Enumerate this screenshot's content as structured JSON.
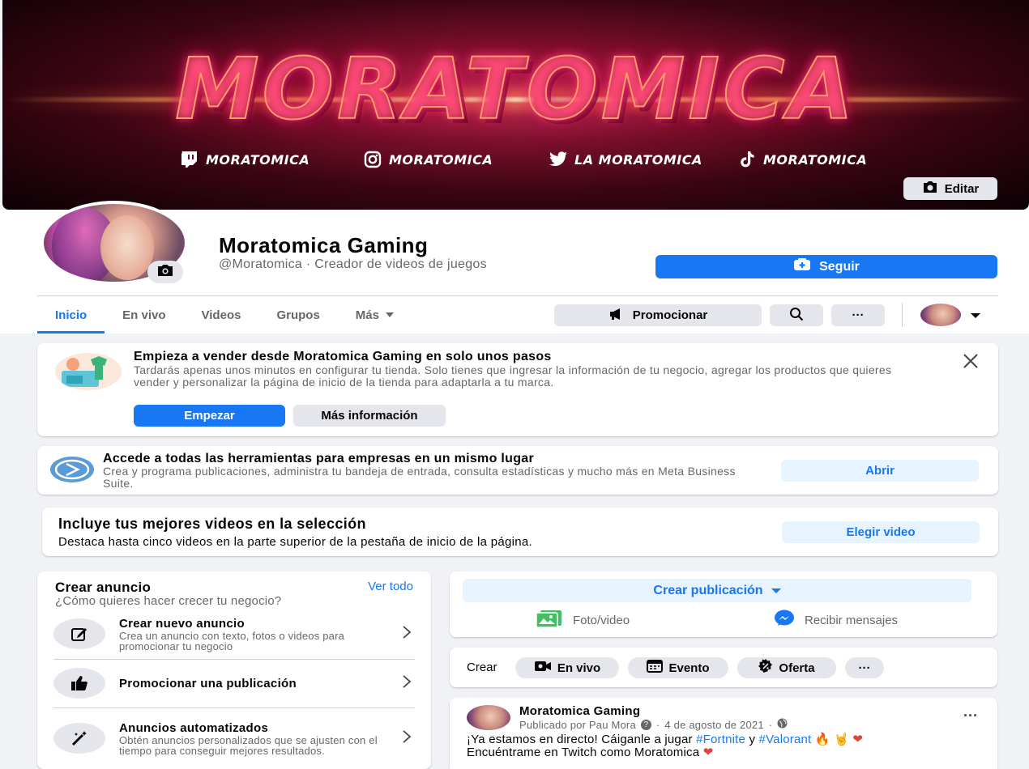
{
  "cover": {
    "brand_text": "MORATOMICA",
    "socials": [
      {
        "icon": "twitch-icon",
        "label": "MORATOMICA"
      },
      {
        "icon": "instagram-icon",
        "label": "MORATOMICA"
      },
      {
        "icon": "twitter-icon",
        "label": "LA MORATOMICA"
      },
      {
        "icon": "tiktok-icon",
        "label": "MORATOMICA"
      }
    ],
    "edit_label": "Editar"
  },
  "profile": {
    "name": "Moratomica Gaming",
    "subtitle": "@Moratomica · Creador de videos de juegos",
    "follow_label": "Seguir"
  },
  "tabs": [
    "Inicio",
    "En vivo",
    "Videos",
    "Grupos",
    "Más"
  ],
  "toolbar": {
    "promote_label": "Promocionar",
    "search_icon": "search-icon",
    "more_label": "···"
  },
  "shop_card": {
    "title": "Empieza a vender desde Moratomica Gaming en solo unos pasos",
    "text": "Tardarás apenas unos minutos en configurar tu tienda. Solo tienes que ingresar la información de tu negocio, agregar los productos que quieres vender y personalizar la página de inicio de la tienda para adaptarla a tu marca.",
    "primary_label": "Empezar",
    "secondary_label": "Más información"
  },
  "business_card": {
    "title": "Accede a todas las herramientas para empresas en un mismo lugar",
    "text": "Crea y programa publicaciones, administra tu bandeja de entrada, consulta estadísticas y mucho más en Meta Business Suite.",
    "button_label": "Abrir"
  },
  "videos_card": {
    "title": "Incluye tus mejores videos en la selección",
    "text": "Destaca hasta cinco videos en la parte superior de la pestaña de inicio de la página.",
    "button_label": "Elegir video"
  },
  "ads": {
    "title": "Crear anuncio",
    "see_all": "Ver todo",
    "subtitle": "¿Cómo quieres hacer crecer tu negocio?",
    "items": [
      {
        "icon": "edit-icon",
        "title": "Crear nuevo anuncio",
        "desc": "Crea un anuncio con texto, fotos o videos para promocionar tu negocio"
      },
      {
        "icon": "thumbs-up-icon",
        "title": "Promocionar una publicación",
        "desc": ""
      },
      {
        "icon": "magic-wand-icon",
        "title": "Anuncios automatizados",
        "desc": "Obtén anuncios personalizados que se ajusten con el tiempo para conseguir mejores resultados."
      }
    ]
  },
  "composer": {
    "create_label": "Crear publicación",
    "photo_label": "Foto/video",
    "messages_label": "Recibir mensajes"
  },
  "create_row": {
    "label": "Crear",
    "pills": [
      "En vivo",
      "Evento",
      "Oferta"
    ],
    "more": "···"
  },
  "post": {
    "author": "Moratomica Gaming",
    "meta": "Publicado por Pau Mora",
    "date": "4 de agosto de 2021",
    "text_prefix": "¡Ya estamos en directo! Cáiganle a jugar",
    "tag1": "#Fortnite",
    "conj": "y",
    "tag2": "#Valorant",
    "emoji1": "🔥 🤘 ❤",
    "line2": "Encuéntrame en Twitch como Moratomica",
    "emoji2": "❤",
    "more": "···"
  },
  "colors": {
    "accent": "#1877f2",
    "background": "#f0f2f5",
    "light_button": "#e7f3ff"
  }
}
